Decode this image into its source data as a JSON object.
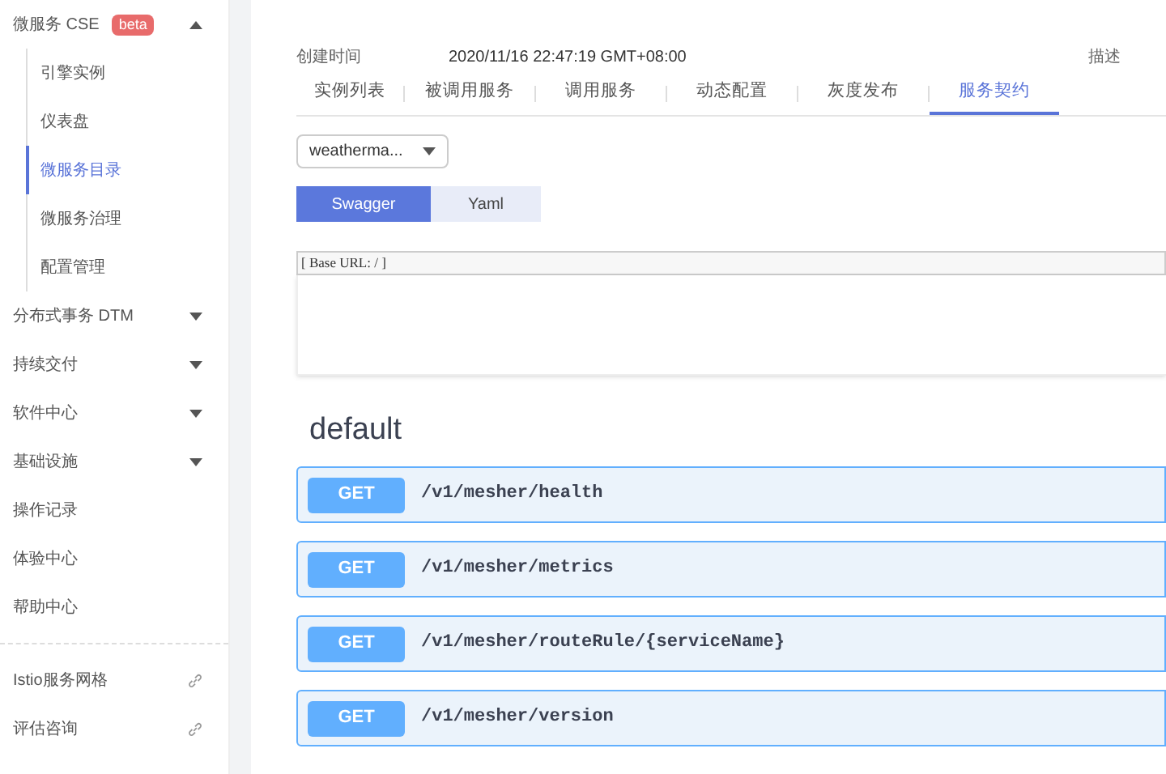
{
  "sidebar": {
    "items": [
      {
        "kind": "menu",
        "label": "微服务 CSE",
        "badge": "beta",
        "expanded": true,
        "children": [
          {
            "label": "引擎实例",
            "selected": false
          },
          {
            "label": "仪表盘",
            "selected": false
          },
          {
            "label": "微服务目录",
            "selected": true
          },
          {
            "label": "微服务治理",
            "selected": false
          },
          {
            "label": "配置管理",
            "selected": false
          }
        ]
      },
      {
        "kind": "menu",
        "label": "分布式事务 DTM",
        "expanded": false
      },
      {
        "kind": "menu",
        "label": "持续交付",
        "expanded": false
      },
      {
        "kind": "menu",
        "label": "软件中心",
        "expanded": false
      },
      {
        "kind": "menu",
        "label": "基础设施",
        "expanded": false
      },
      {
        "kind": "plain",
        "label": "操作记录"
      },
      {
        "kind": "plain",
        "label": "体验中心"
      },
      {
        "kind": "plain",
        "label": "帮助中心"
      },
      {
        "kind": "divider"
      },
      {
        "kind": "link",
        "label": "Istio服务网格"
      },
      {
        "kind": "link",
        "label": "评估咨询"
      }
    ]
  },
  "details": {
    "created_label": "创建时间",
    "created_value": "2020/11/16 22:47:19 GMT+08:00",
    "description_label": "描述"
  },
  "tabs": [
    {
      "label": "实例列表",
      "selected": false
    },
    {
      "label": "被调用服务",
      "selected": false
    },
    {
      "label": "调用服务",
      "selected": false
    },
    {
      "label": "动态配置",
      "selected": false
    },
    {
      "label": "灰度发布",
      "selected": false
    },
    {
      "label": "服务契约",
      "selected": true
    }
  ],
  "version_select": {
    "value": "weatherma..."
  },
  "format_toggle": [
    {
      "label": "Swagger",
      "selected": true
    },
    {
      "label": "Yaml",
      "selected": false
    }
  ],
  "base_url": "[ Base URL: / ]",
  "section_title": "default",
  "endpoints": [
    {
      "method": "GET",
      "path": "/v1/mesher/health"
    },
    {
      "method": "GET",
      "path": "/v1/mesher/metrics"
    },
    {
      "method": "GET",
      "path": "/v1/mesher/routeRule/{serviceName}"
    },
    {
      "method": "GET",
      "path": "/v1/mesher/version"
    }
  ]
}
